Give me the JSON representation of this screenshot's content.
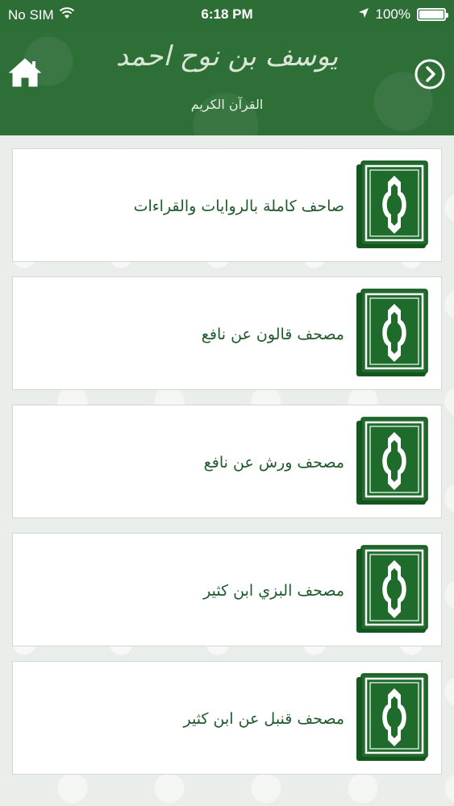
{
  "status_bar": {
    "carrier": "No SIM",
    "time": "6:18 PM",
    "battery_percent": "100%",
    "battery_level": 1.0,
    "icons": [
      "wifi-icon",
      "location-arrow-icon",
      "battery-icon"
    ]
  },
  "header": {
    "calligraphy": "يوسف بن نوح احمد",
    "subtitle": "القرآن الكريم",
    "home_icon": "home-icon",
    "next_icon": "chevron-right-circle-icon"
  },
  "list": {
    "items": [
      {
        "title": "صاحف كاملة بالروايات والقراءات",
        "icon": "quran-book-icon"
      },
      {
        "title": "مصحف قالون عن نافع",
        "icon": "quran-book-icon"
      },
      {
        "title": "مصحف ورش عن نافع",
        "icon": "quran-book-icon"
      },
      {
        "title": "مصحف البزي ابن كثير",
        "icon": "quran-book-icon"
      },
      {
        "title": "مصحف قنبل عن ابن كثير",
        "icon": "quran-book-icon"
      }
    ]
  },
  "colors": {
    "brand_green": "#2e6f38",
    "title_green": "#1f5a2a",
    "book_green": "#1e6b2c"
  }
}
